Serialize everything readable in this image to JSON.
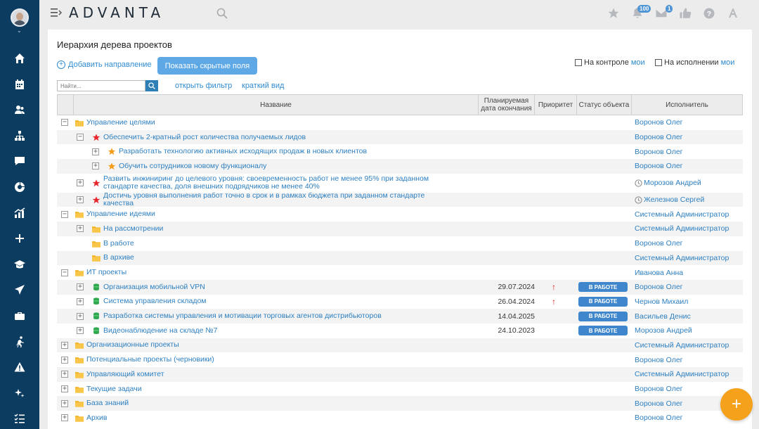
{
  "app": {
    "logo": "ADVANTA",
    "logo_accent": "#2f8bd0"
  },
  "topbar": {
    "mail_badge": "100",
    "like_badge": "1"
  },
  "sidebar": {
    "icons": [
      "home-icon",
      "calendar-icon",
      "users-icon",
      "hierarchy-icon",
      "chat-icon",
      "chart-donut-icon",
      "analytics-icon",
      "plus-icon",
      "education-icon",
      "plane-icon",
      "briefcase-icon",
      "running-icon",
      "warning-icon",
      "sparkle-icon",
      "checklist-icon"
    ]
  },
  "page": {
    "title": "Иерархия дерева проектов",
    "add_direction": "Добавить направление",
    "show_hidden": "Показать скрытые поля",
    "on_control": "На контроле",
    "on_control_mine": "мои",
    "in_progress": "На исполнении",
    "in_progress_mine": "мои",
    "search_placeholder": "Найти...",
    "open_filter": "открыть фильтр",
    "short_view": "краткий вид"
  },
  "table": {
    "headers": {
      "name": "Название",
      "date": "Планируемая дата окончания",
      "priority": "Приоритет",
      "status": "Статус объекта",
      "executor": "Исполнитель"
    },
    "rows": [
      {
        "level": 0,
        "exp": "−",
        "icon": "folder",
        "name": "Управление целями",
        "date": "",
        "prio": "",
        "status": "",
        "executor": "Воронов Олег",
        "clock": false
      },
      {
        "level": 1,
        "exp": "−",
        "icon": "star-red",
        "name": "Обеспечить 2-кратный рост количества получаемых лидов",
        "date": "",
        "prio": "",
        "status": "",
        "executor": "Воронов Олег",
        "clock": false
      },
      {
        "level": 2,
        "exp": "+",
        "icon": "star-orange",
        "name": "Разработать технологию активных исходящих продаж в новых клиентов",
        "date": "",
        "prio": "",
        "status": "",
        "executor": "Воронов Олег",
        "clock": false
      },
      {
        "level": 2,
        "exp": "+",
        "icon": "star-orange",
        "name": "Обучить сотрудников новому функционалу",
        "date": "",
        "prio": "",
        "status": "",
        "executor": "Воронов Олег",
        "clock": false
      },
      {
        "level": 1,
        "exp": "+",
        "icon": "star-red",
        "name": "Развить инжиниринг до целевого уровня: своевременность работ не менее 95% при заданном стандарте качества, доля внешних подрядчиков не менее 40%",
        "date": "",
        "prio": "",
        "status": "",
        "executor": "Морозов Андрей",
        "clock": true
      },
      {
        "level": 1,
        "exp": "+",
        "icon": "star-red",
        "name": "Достичь уровня выполнения работ точно в срок и в рамках бюджета при заданном стандарте качества",
        "date": "",
        "prio": "",
        "status": "",
        "executor": "Железнов Сергей",
        "clock": true
      },
      {
        "level": 0,
        "exp": "−",
        "icon": "folder",
        "name": "Управление идеями",
        "date": "",
        "prio": "",
        "status": "",
        "executor": "Системный Администратор",
        "clock": false
      },
      {
        "level": 1,
        "exp": "+",
        "icon": "folder",
        "name": "На рассмотрении",
        "date": "",
        "prio": "",
        "status": "",
        "executor": "Системный Администратор",
        "clock": false
      },
      {
        "level": 1,
        "exp": "",
        "icon": "folder",
        "name": "В работе",
        "date": "",
        "prio": "",
        "status": "",
        "executor": "Воронов Олег",
        "clock": false
      },
      {
        "level": 1,
        "exp": "",
        "icon": "folder",
        "name": "В архиве",
        "date": "",
        "prio": "",
        "status": "",
        "executor": "Системный Администратор",
        "clock": false
      },
      {
        "level": 0,
        "exp": "−",
        "icon": "folder",
        "name": "ИТ проекты",
        "date": "",
        "prio": "",
        "status": "",
        "executor": "Иванова Анна",
        "clock": false
      },
      {
        "level": 1,
        "exp": "+",
        "icon": "db",
        "name": "Организация мобильной VPN",
        "date": "29.07.2024",
        "prio": "↑",
        "status": "В РАБОТЕ",
        "executor": "Воронов Олег",
        "clock": false
      },
      {
        "level": 1,
        "exp": "+",
        "icon": "db",
        "name": "Система управления складом",
        "date": "26.04.2024",
        "prio": "↑",
        "status": "В РАБОТЕ",
        "executor": "Чернов Михаил",
        "clock": false
      },
      {
        "level": 1,
        "exp": "+",
        "icon": "db",
        "name": "Разработка системы управления и мотивации торговых агентов дистрибьюторов",
        "date": "14.04.2025",
        "prio": "",
        "status": "В РАБОТЕ",
        "executor": "Васильев Денис",
        "clock": false
      },
      {
        "level": 1,
        "exp": "+",
        "icon": "db",
        "name": "Видеонаблюдение на складе №7",
        "date": "24.10.2023",
        "prio": "",
        "status": "В РАБОТЕ",
        "executor": "Морозов Андрей",
        "clock": false
      },
      {
        "level": 0,
        "exp": "+",
        "icon": "folder",
        "name": "Организационные проекты",
        "date": "",
        "prio": "",
        "status": "",
        "executor": "Системный Администратор",
        "clock": false
      },
      {
        "level": 0,
        "exp": "+",
        "icon": "folder",
        "name": "Потенциальные проекты (черновики)",
        "date": "",
        "prio": "",
        "status": "",
        "executor": "Воронов Олег",
        "clock": false
      },
      {
        "level": 0,
        "exp": "+",
        "icon": "folder",
        "name": "Управляющий комитет",
        "date": "",
        "prio": "",
        "status": "",
        "executor": "Системный Администратор",
        "clock": false
      },
      {
        "level": 0,
        "exp": "+",
        "icon": "folder",
        "name": "Текущие задачи",
        "date": "",
        "prio": "",
        "status": "",
        "executor": "Воронов Олег",
        "clock": false
      },
      {
        "level": 0,
        "exp": "+",
        "icon": "folder",
        "name": "База знаний",
        "date": "",
        "prio": "",
        "status": "",
        "executor": "Воронов Олег",
        "clock": false
      },
      {
        "level": 0,
        "exp": "+",
        "icon": "folder",
        "name": "Архив",
        "date": "",
        "prio": "",
        "status": "",
        "executor": "Воронов Олег",
        "clock": false
      }
    ]
  },
  "fab": {
    "label": "+"
  }
}
